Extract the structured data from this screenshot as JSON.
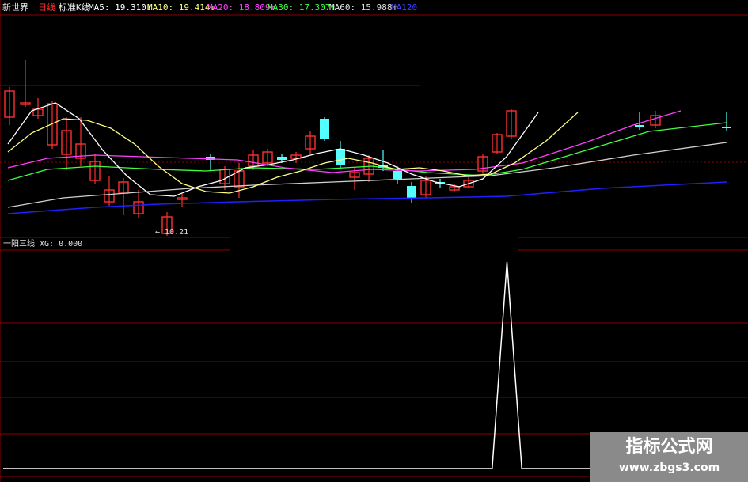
{
  "header": {
    "stock": "新世界",
    "period": "日线",
    "style": "标准K线",
    "ma5": "MA5: 19.310↓",
    "ma10": "MA10: 19.414↓",
    "ma20": "MA20: 18.809↑",
    "ma30": "MA30: 17.307↑",
    "ma60": "MA60: 15.988↑",
    "ma120": "MA120"
  },
  "colors": {
    "up": "#ff3030",
    "down": "#54ffff",
    "ma5": "#ffffff",
    "ma10": "#ffff80",
    "ma20": "#ff40ff",
    "ma30": "#40ff40",
    "ma60": "#d0d0d0",
    "ma120": "#2020ff",
    "grid": "#8b0000"
  },
  "price_chart": {
    "low_label": "← 10.21"
  },
  "indicator": {
    "label": "一阳三线  XG: 0.000",
    "values": [
      0,
      0,
      0,
      0,
      0,
      0,
      0,
      0,
      0,
      0,
      0,
      0,
      0,
      0,
      0,
      0,
      0,
      0,
      0,
      0,
      0,
      0,
      0,
      0,
      0,
      0,
      0,
      0,
      0,
      0,
      0,
      0,
      0,
      0,
      1,
      0,
      0,
      0,
      0,
      0,
      0,
      0,
      0,
      0,
      0,
      0,
      0,
      0,
      0,
      0,
      0
    ]
  },
  "watermark": {
    "title": "指标公式网",
    "url": "www.zbgs3.com"
  }
}
